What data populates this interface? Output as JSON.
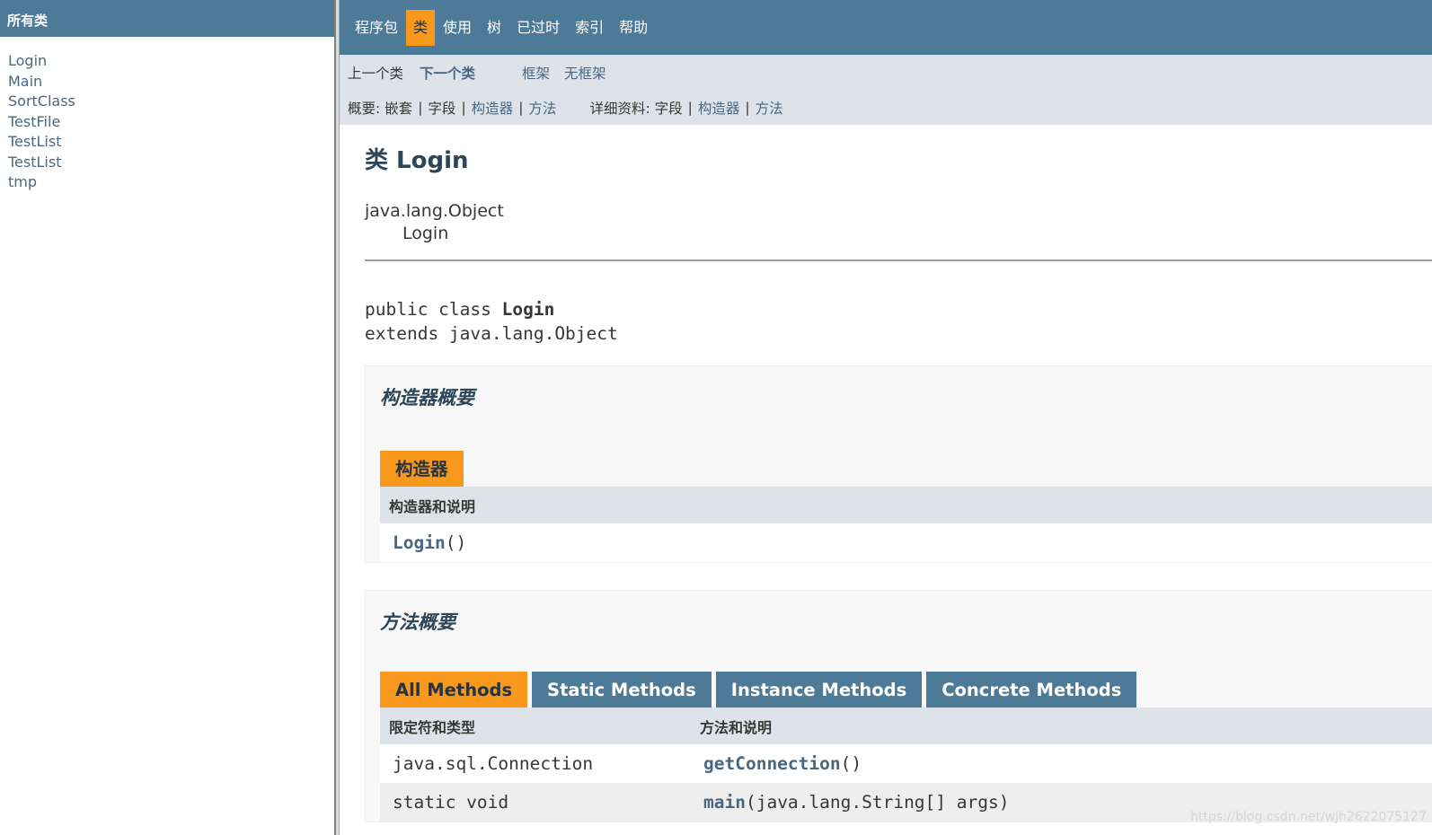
{
  "left_frame": {
    "header": "所有类",
    "classes": [
      "Login",
      "Main",
      "SortClass",
      "TestFile",
      "TestList",
      "TestList",
      "tmp"
    ]
  },
  "top_nav": {
    "items": [
      "程序包",
      "类",
      "使用",
      "树",
      "已过时",
      "索引",
      "帮助"
    ],
    "active_index": 1
  },
  "sub_nav": {
    "prev_class": "上一个类",
    "next_class": "下一个类",
    "frames": "框架",
    "no_frames": "无框架",
    "summary_label": "概要:",
    "summary_nested": "嵌套",
    "summary_field": "字段",
    "summary_constructor": "构造器",
    "summary_method": "方法",
    "detail_label": "详细资料:",
    "detail_field": "字段",
    "detail_constructor": "构造器",
    "detail_method": "方法",
    "separator": "|"
  },
  "class_page": {
    "title": "类 Login",
    "inheritance_parent": "java.lang.Object",
    "inheritance_child": "Login",
    "decl_prefix": "public class ",
    "decl_name": "Login",
    "decl_extends": "extends java.lang.Object"
  },
  "constructor_summary": {
    "heading": "构造器概要",
    "tab": "构造器",
    "column_header": "构造器和说明",
    "rows": [
      {
        "name": "Login",
        "params": "()"
      }
    ]
  },
  "method_summary": {
    "heading": "方法概要",
    "tabs": [
      "All Methods",
      "Static Methods",
      "Instance Methods",
      "Concrete Methods"
    ],
    "active_tab": 0,
    "col_modifier": "限定符和类型",
    "col_method": "方法和说明",
    "rows": [
      {
        "modifier": "java.sql.Connection",
        "name": "getConnection",
        "params": "()"
      },
      {
        "modifier": "static void",
        "name": "main",
        "params": "(java.lang.String[] args)"
      }
    ]
  },
  "watermark": "https://blog.csdn.net/wjh2622075127",
  "colors": {
    "nav_blue": "#4d7a97",
    "active_orange": "#f8981d",
    "subnav_gray": "#dee3e9",
    "link_blue": "#4a6782"
  }
}
